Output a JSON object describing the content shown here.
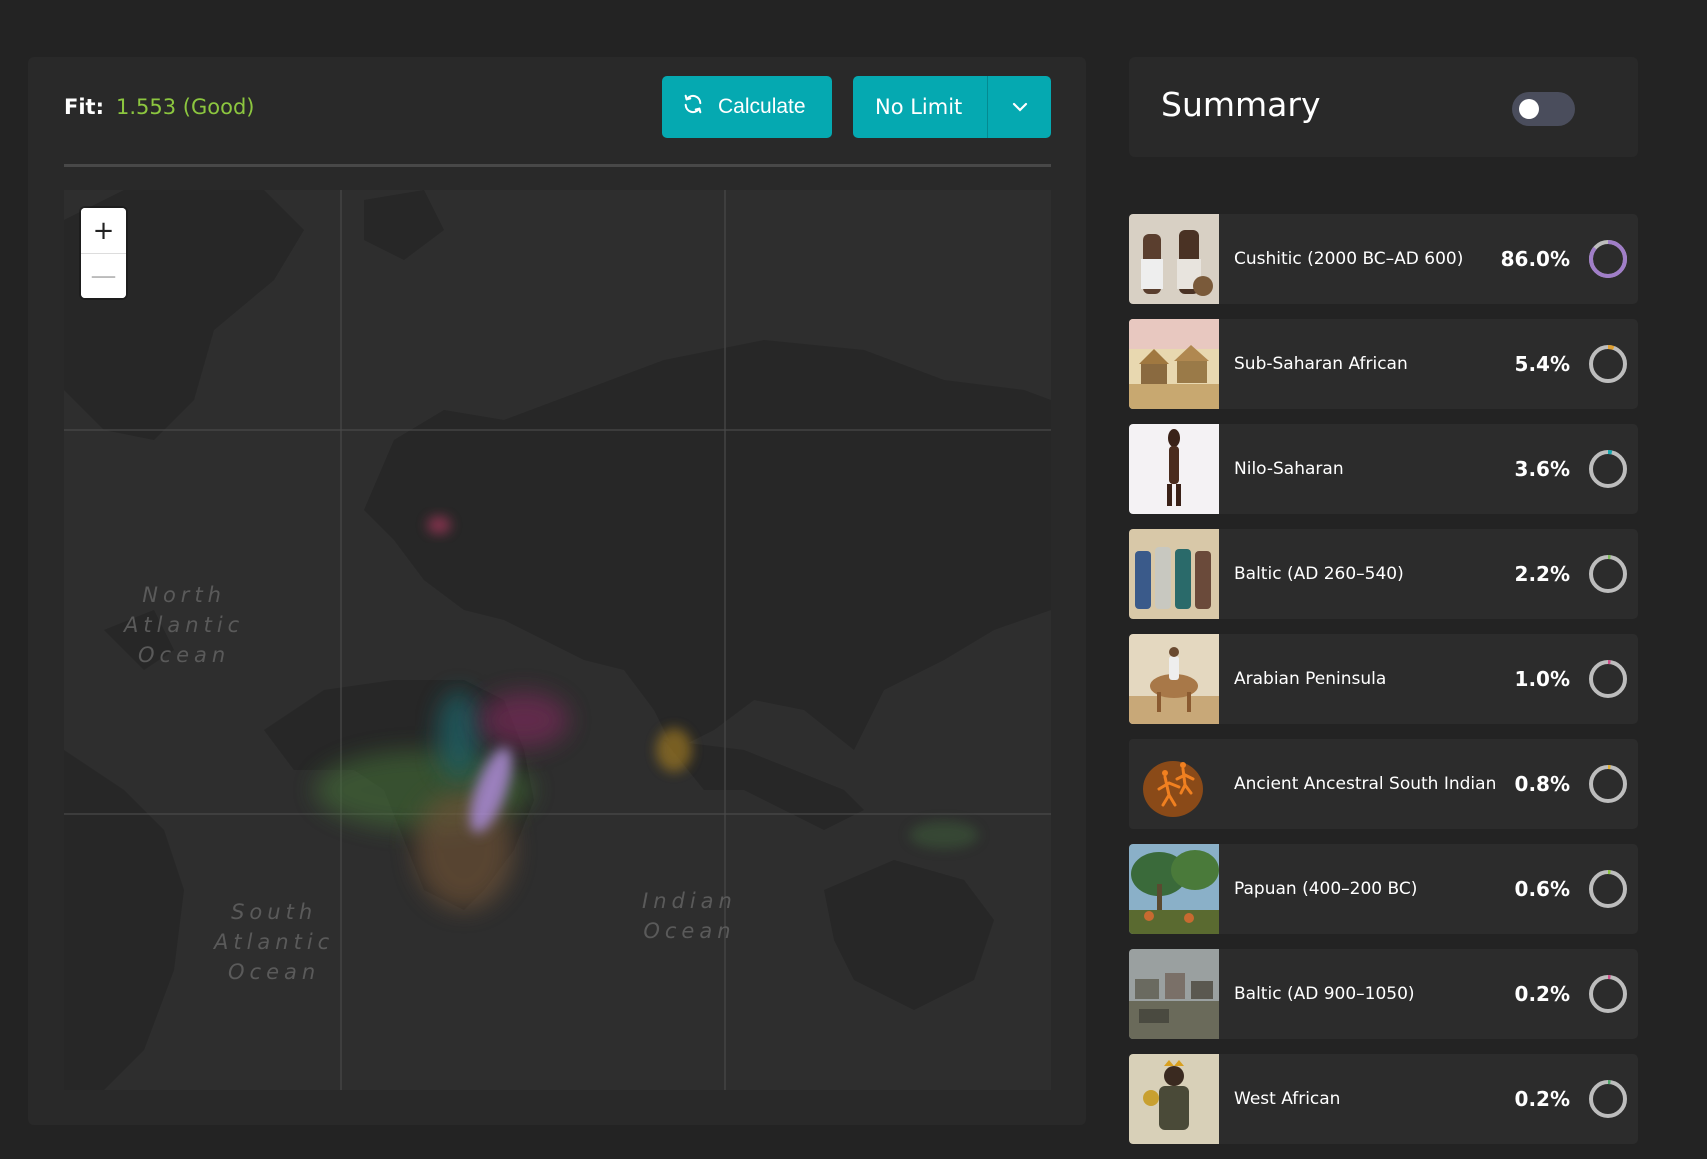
{
  "fit": {
    "label": "Fit:",
    "value": "1.553 (Good)"
  },
  "toolbar": {
    "calculate_label": "Calculate",
    "limit_label": "No Limit"
  },
  "map": {
    "zoom_in": "+",
    "zoom_out": "—",
    "oceans": {
      "north_atlantic": "North\nAtlantic\nOcean",
      "south_atlantic": "South\nAtlantic\nOcean",
      "indian": "Indian\nOcean"
    }
  },
  "summary": {
    "title": "Summary",
    "toggle_on": false
  },
  "populations": [
    {
      "name": "Cushitic (2000 BC–AD 600)",
      "percent": "86.0%",
      "fraction": 0.86,
      "color": "#a07ec8"
    },
    {
      "name": "Sub-Saharan African",
      "percent": "5.4%",
      "fraction": 0.054,
      "color": "#e0a030"
    },
    {
      "name": "Nilo-Saharan",
      "percent": "3.6%",
      "fraction": 0.036,
      "color": "#16a9b0"
    },
    {
      "name": "Baltic (AD 260–540)",
      "percent": "2.2%",
      "fraction": 0.022,
      "color": "#7cbb56"
    },
    {
      "name": "Arabian Peninsula",
      "percent": "1.0%",
      "fraction": 0.01,
      "color": "#d04f8a"
    },
    {
      "name": "Ancient Ancestral South Indian",
      "percent": "0.8%",
      "fraction": 0.008,
      "color": "#e0b030"
    },
    {
      "name": "Papuan (400–200 BC)",
      "percent": "0.6%",
      "fraction": 0.006,
      "color": "#8cc63f"
    },
    {
      "name": "Baltic (AD 900–1050)",
      "percent": "0.2%",
      "fraction": 0.002,
      "color": "#d04f8a"
    },
    {
      "name": "West African",
      "percent": "0.2%",
      "fraction": 0.002,
      "color": "#4fa86a"
    }
  ]
}
